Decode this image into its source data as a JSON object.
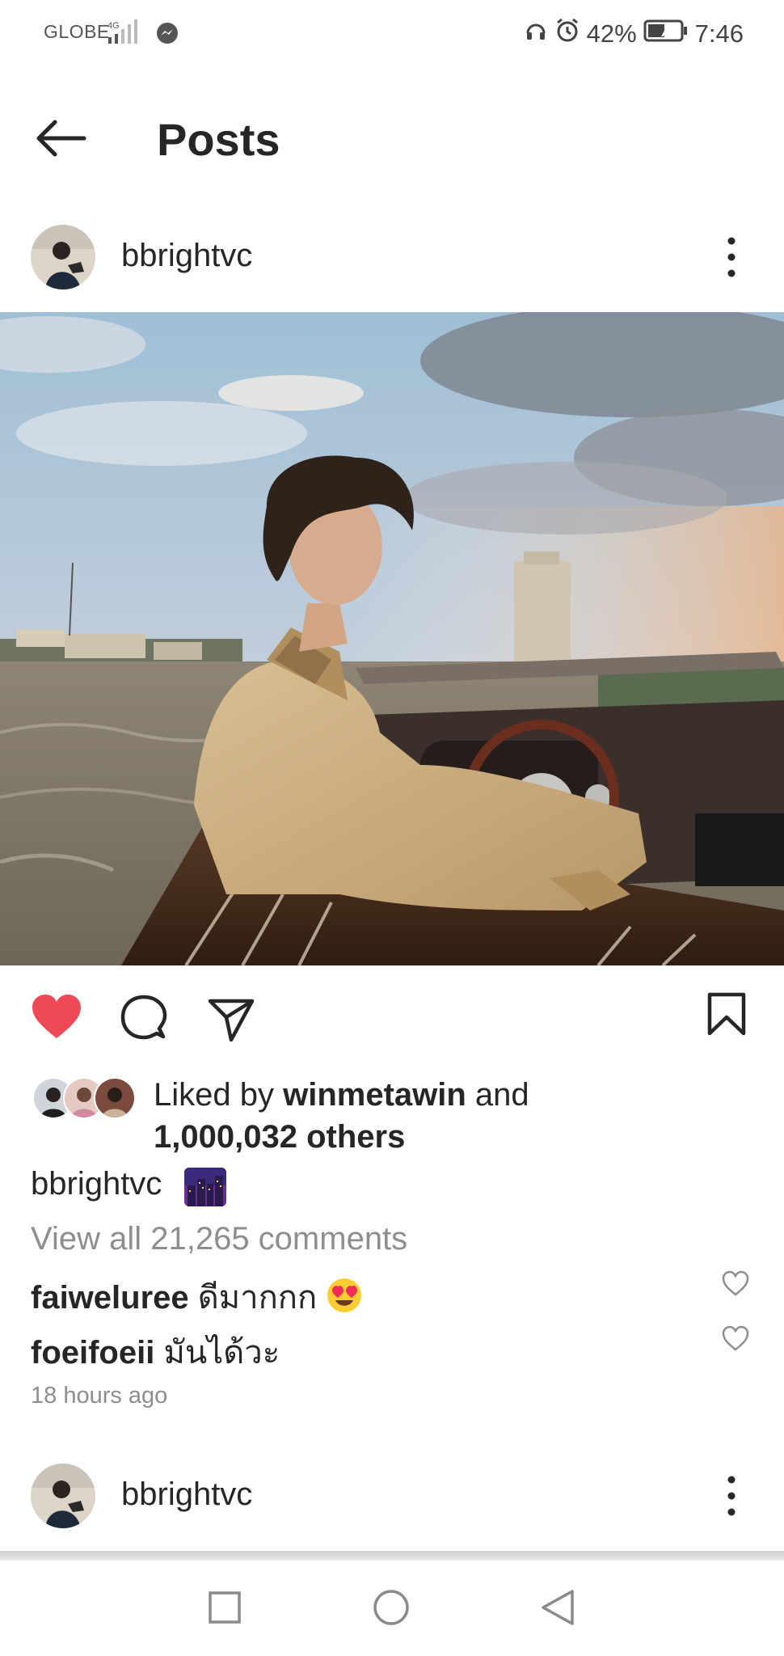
{
  "status_bar": {
    "carrier": "GLOBE",
    "network": "4G",
    "battery": "42%",
    "time": "7:46"
  },
  "header": {
    "title": "Posts"
  },
  "post": {
    "username": "bbrightvc",
    "liked_by_prefix": "Liked by ",
    "liked_by_user": "winmetawin",
    "liked_by_and": " and",
    "likes_others": "1,000,032 others",
    "caption_user": "bbrightvc",
    "view_all_comments": "View all 21,265 comments",
    "comments": [
      {
        "user": "faiweluree",
        "text": "ดีมากกก"
      },
      {
        "user": "foeifoeii",
        "text": "มันได้วะ"
      }
    ],
    "timestamp": "18 hours ago",
    "liked": true
  },
  "next_post": {
    "username": "bbrightvc"
  },
  "colors": {
    "like_red": "#ed4956",
    "text": "#262626",
    "muted": "#8e8e8e"
  },
  "icons": [
    "back-arrow-icon",
    "more-vertical-icon",
    "heart-icon",
    "comment-icon",
    "share-icon",
    "bookmark-icon",
    "square-nav-icon",
    "circle-nav-icon",
    "triangle-back-nav-icon"
  ]
}
